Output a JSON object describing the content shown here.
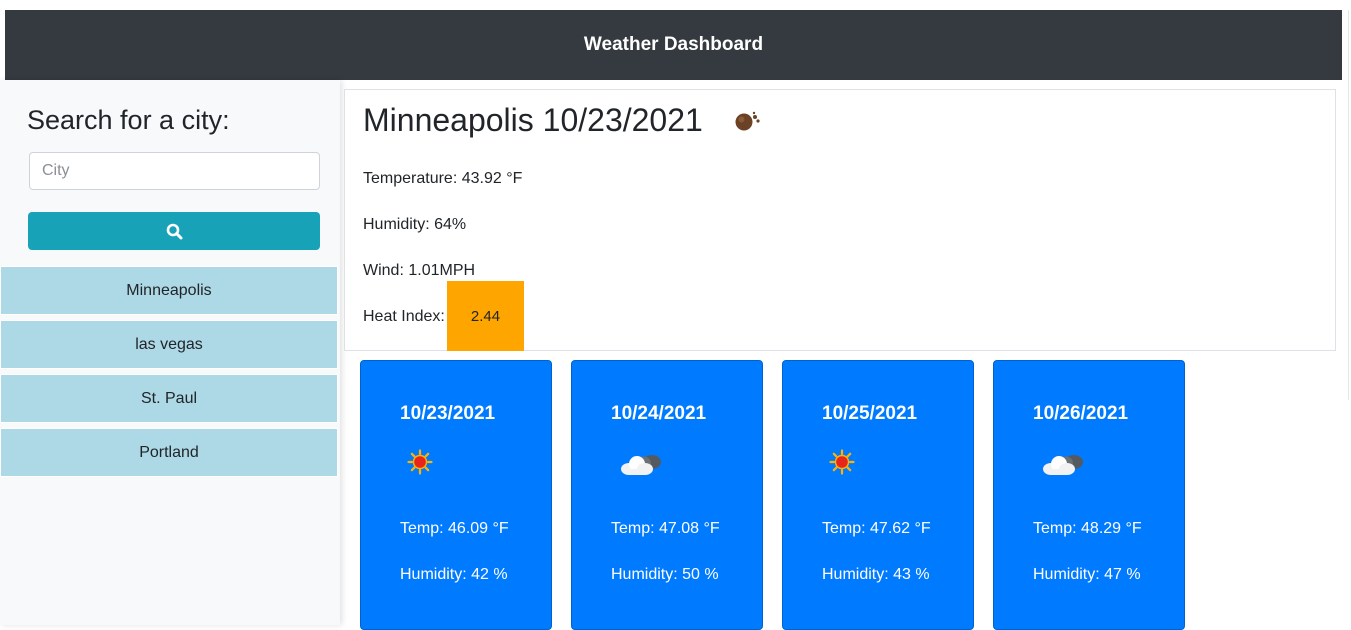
{
  "header": {
    "title": "Weather Dashboard"
  },
  "sidebar": {
    "heading": "Search for a city:",
    "search": {
      "placeholder": "City",
      "value": ""
    },
    "search_button_icon": "search-icon",
    "history": [
      "Minneapolis",
      "las vegas",
      "St. Paul",
      "Portland"
    ]
  },
  "current": {
    "title": "Minneapolis 10/23/2021",
    "icon": "dust-icon",
    "temperature": "Temperature: 43.92 °F",
    "humidity": "Humidity: 64%",
    "wind": "Wind: 1.01MPH",
    "heat_index_label": "Heat Index:",
    "heat_index_value": "2.44",
    "heat_index_color": "#ffa500"
  },
  "forecast": [
    {
      "date": "10/23/2021",
      "icon": "sun-icon",
      "temp": "Temp: 46.09 °F",
      "humidity": "Humidity: 42 %"
    },
    {
      "date": "10/24/2021",
      "icon": "cloud-icon",
      "temp": "Temp: 47.08 °F",
      "humidity": "Humidity: 50 %"
    },
    {
      "date": "10/25/2021",
      "icon": "sun-icon",
      "temp": "Temp: 47.62 °F",
      "humidity": "Humidity: 43 %"
    },
    {
      "date": "10/26/2021",
      "icon": "cloud-icon",
      "temp": "Temp: 48.29 °F",
      "humidity": "Humidity: 47 %"
    }
  ],
  "colors": {
    "navbar": "#343a40",
    "search_button": "#17a2b8",
    "history_item": "#add8e6",
    "forecast_card": "#007bff"
  }
}
